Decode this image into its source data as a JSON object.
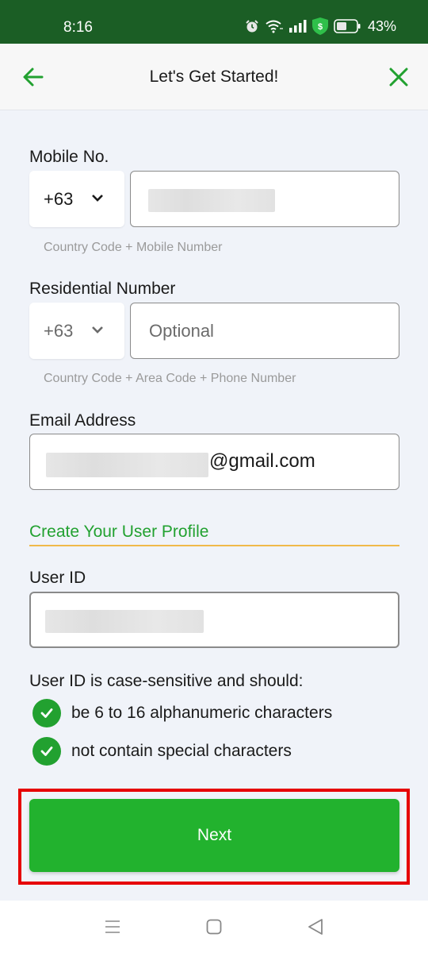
{
  "status_bar": {
    "time": "8:16",
    "icons": [
      "alarm-icon",
      "wifi-icon",
      "signal-icon",
      "shield-dollar-icon",
      "battery-icon"
    ],
    "battery_percent": "43%"
  },
  "app_bar": {
    "title": "Let's Get Started!",
    "back_icon": "arrow-left-icon",
    "close_icon": "close-icon",
    "accent_color": "#22a130"
  },
  "form": {
    "mobile": {
      "label": "Mobile No.",
      "country_code": "+63",
      "value": "",
      "value_redacted": true,
      "helper": "Country Code + Mobile Number"
    },
    "residential": {
      "label": "Residential Number",
      "country_code": "+63",
      "placeholder": "Optional",
      "helper": "Country Code + Area Code + Phone Number"
    },
    "email": {
      "label": "Email Address",
      "value_suffix": "@gmail.com",
      "value_redacted": true
    },
    "profile_section": {
      "title": "Create Your User Profile"
    },
    "user_id": {
      "label": "User ID",
      "value_redacted": true
    },
    "rules": {
      "intro": "User ID is case-sensitive and should:",
      "items": [
        {
          "text": "be 6 to 16 alphanumeric characters",
          "status": "check"
        },
        {
          "text": "not contain special characters",
          "status": "check"
        }
      ]
    },
    "next_button": "Next"
  },
  "colors": {
    "status_bar": "#1b5e25",
    "primary_green": "#22b22e",
    "section_rule": "#f0b94a",
    "highlight": "#e60000"
  },
  "nav_bar": {
    "buttons": [
      "menu-icon",
      "home-icon",
      "back-triangle-icon"
    ]
  }
}
